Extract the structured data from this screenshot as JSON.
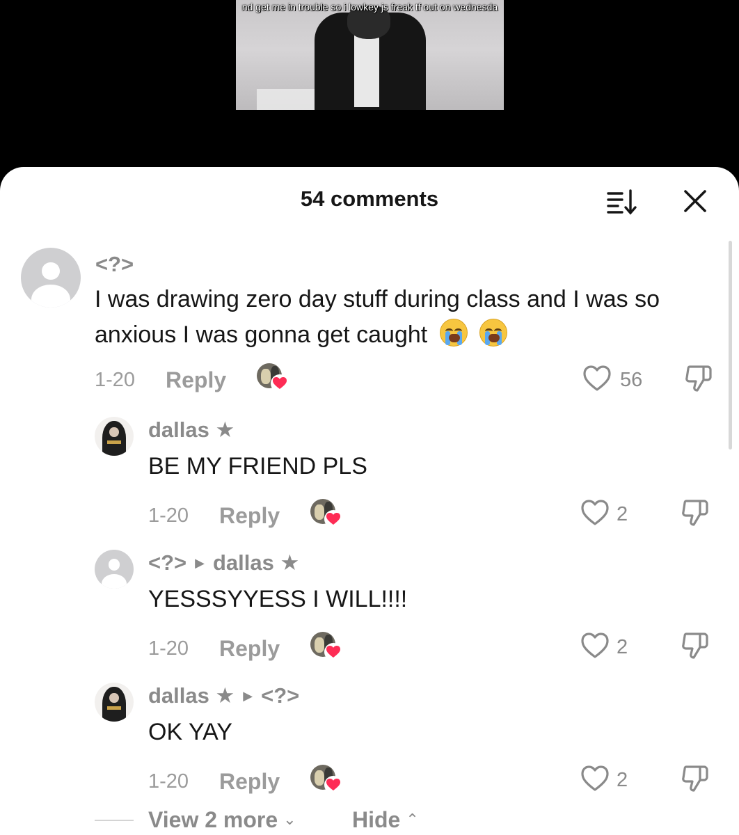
{
  "video": {
    "caption": "nd get me in trouble so i lowkey js freak tf out on wednesda"
  },
  "header": {
    "comment_count": "54 comments"
  },
  "comments": [
    {
      "username": "<?>",
      "text": "I was drawing zero day stuff during class and I was so anxious I was gonna get caught",
      "emojis": [
        "loudly-crying-face",
        "loudly-crying-face"
      ],
      "date": "1-20",
      "reply_label": "Reply",
      "likes": "56",
      "avatar": "default"
    },
    {
      "username": "dallas ★",
      "text": "BE MY FRIEND PLS",
      "date": "1-20",
      "reply_label": "Reply",
      "likes": "2",
      "avatar": "photo"
    },
    {
      "username": "<?>",
      "reply_to": "dallas ★",
      "text": "YESSSYYESS I WILL!!!!",
      "date": "1-20",
      "reply_label": "Reply",
      "likes": "2",
      "avatar": "default"
    },
    {
      "username": "dallas ★",
      "reply_to": "<?>",
      "text": "OK YAY",
      "date": "1-20",
      "reply_label": "Reply",
      "likes": "2",
      "avatar": "photo"
    }
  ],
  "footer": {
    "view_more_label": "View 2 more",
    "hide_label": "Hide"
  },
  "colors": {
    "creator_heart": "#fe2c55",
    "muted_text": "#8a8a8a"
  }
}
